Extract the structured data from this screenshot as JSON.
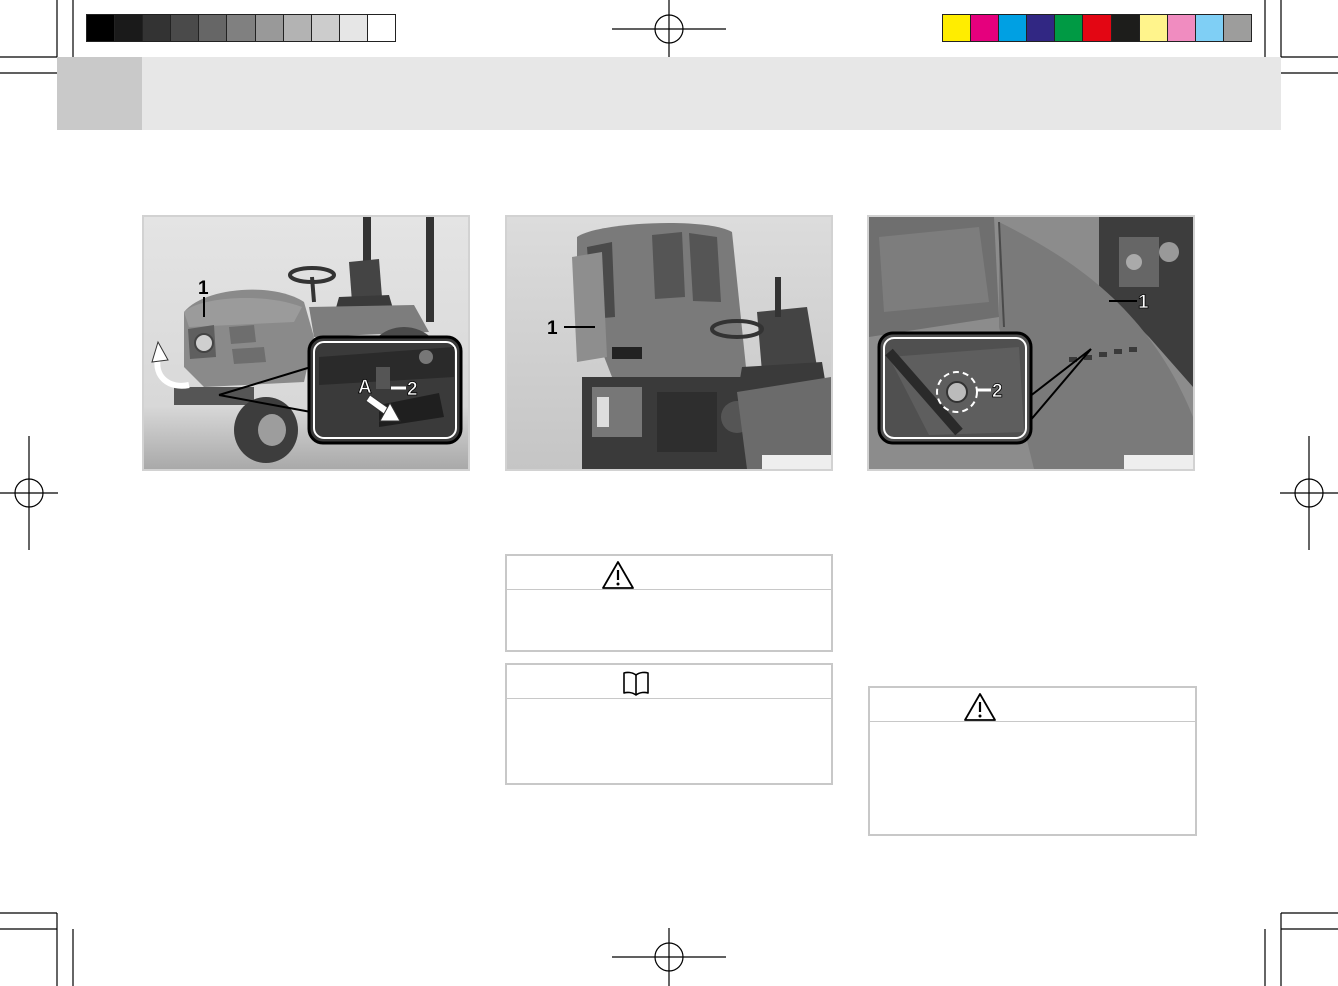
{
  "print_marks": {
    "grayscale_bar": [
      "#000000",
      "#1a1a1a",
      "#333333",
      "#4a4a4a",
      "#666666",
      "#808080",
      "#999999",
      "#b3b3b3",
      "#cccccc",
      "#e6e6e6",
      "#ffffff"
    ],
    "color_bar": [
      "#ffed00",
      "#e5007d",
      "#00a0e3",
      "#312783",
      "#009a44",
      "#e30613",
      "#1d1d1b",
      "#fff48c",
      "#f08cc0",
      "#7fcff5",
      "#9d9d9c"
    ]
  },
  "header": {
    "bar_color": "#e7e7e7",
    "tab_color": "#c9c9c9"
  },
  "figures": [
    {
      "name": "tractor-hood-release",
      "callouts": {
        "one": "1",
        "two": "2",
        "a": "A"
      }
    },
    {
      "name": "hood-raised",
      "callouts": {
        "one": "1"
      }
    },
    {
      "name": "side-panel-screw",
      "callouts": {
        "one": "1",
        "two": "2"
      }
    }
  ],
  "notices": [
    {
      "type": "warning",
      "icon": "warning-triangle-icon"
    },
    {
      "type": "note",
      "icon": "book-icon"
    },
    {
      "type": "warning",
      "icon": "warning-triangle-icon"
    }
  ]
}
